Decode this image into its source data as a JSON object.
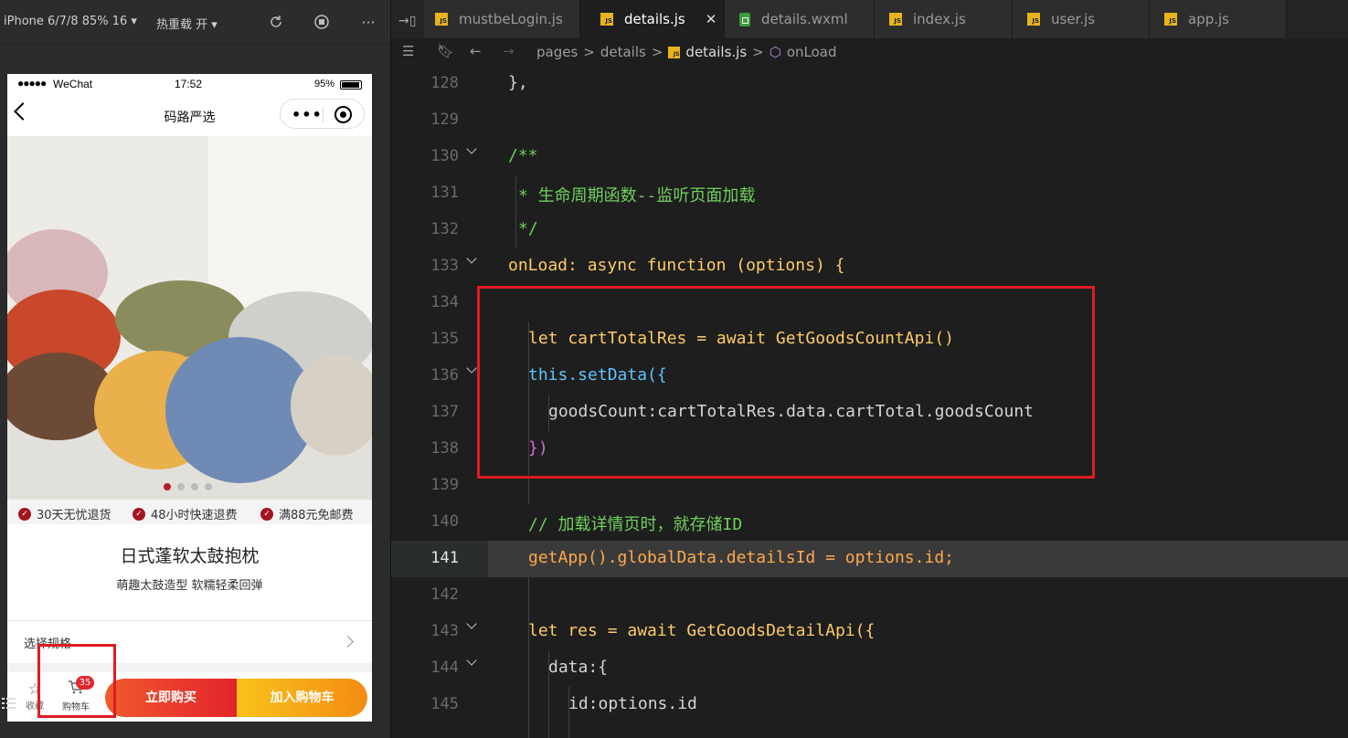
{
  "simulator": {
    "device_label": "iPhone 6/7/8 85% 16 ▾",
    "hotreload_label": "热重载 开 ▾",
    "statusbar": {
      "signal": "●●●●●",
      "carrier": "WeChat",
      "time": "17:52",
      "battery": "95%"
    },
    "navbar": {
      "title": "码路严选",
      "menu_dots": "•••"
    },
    "services": [
      "30天无忧退货",
      "48小时快速退费",
      "满88元免邮费"
    ],
    "product": {
      "title": "日式蓬软太鼓抱枕",
      "subtitle": "萌趣太鼓造型 软糯轻柔回弹"
    },
    "spec_label": "选择规格",
    "bottom_bar": {
      "fav_label": "收藏",
      "cart_label": "购物车",
      "cart_badge": "35",
      "buy_now": "立即购买",
      "add_to_cart": "加入购物车"
    },
    "swiper": {
      "count": 4,
      "active_index": 0
    },
    "colors": {
      "accent_red": "#e4242b",
      "accent_orange": "#f48c14",
      "service_check": "#a3151f"
    }
  },
  "editor": {
    "tabs": [
      {
        "label": "mustbeLogin.js",
        "icon": "js-file-icon",
        "active": false
      },
      {
        "label": "details.js",
        "icon": "js-file-icon",
        "active": true
      },
      {
        "label": "details.wxml",
        "icon": "wxml-file-icon",
        "active": false
      },
      {
        "label": "index.js",
        "icon": "js-file-icon",
        "active": false
      },
      {
        "label": "user.js",
        "icon": "js-file-icon",
        "active": false
      },
      {
        "label": "app.js",
        "icon": "js-file-icon",
        "active": false
      }
    ],
    "breadcrumb": {
      "pages": "pages",
      "details": "details",
      "file": "details.js",
      "symbol": "onLoad"
    },
    "current_line": 141,
    "lines": [
      {
        "n": "128",
        "text": "},"
      },
      {
        "n": "129",
        "text": ""
      },
      {
        "n": "130",
        "text": "/**"
      },
      {
        "n": "131",
        "text": "* 生命周期函数--监听页面加载"
      },
      {
        "n": "132",
        "text": "*/"
      },
      {
        "n": "133",
        "text": "onLoad: async function (options) {"
      },
      {
        "n": "134",
        "text": ""
      },
      {
        "n": "135",
        "text": "let cartTotalRes = await GetGoodsCountApi()"
      },
      {
        "n": "136",
        "text": "this.setData({"
      },
      {
        "n": "137",
        "text": "goodsCount:cartTotalRes.data.cartTotal.goodsCount"
      },
      {
        "n": "138",
        "text": "})"
      },
      {
        "n": "139",
        "text": ""
      },
      {
        "n": "140",
        "text": "// 加载详情页时，就存储ID"
      },
      {
        "n": "141",
        "text": "getApp().globalData.detailsId = options.id;"
      },
      {
        "n": "142",
        "text": ""
      },
      {
        "n": "143",
        "text": "let res = await GetGoodsDetailApi({"
      },
      {
        "n": "144",
        "text": "data:{"
      },
      {
        "n": "145",
        "text": "id:options.id"
      }
    ],
    "colors": {
      "background": "#1e1e1e",
      "keyword": "#ffcc66",
      "function": "#ffa94d",
      "comment": "#6fcf5d",
      "highlight_box": "#e01b22"
    }
  }
}
